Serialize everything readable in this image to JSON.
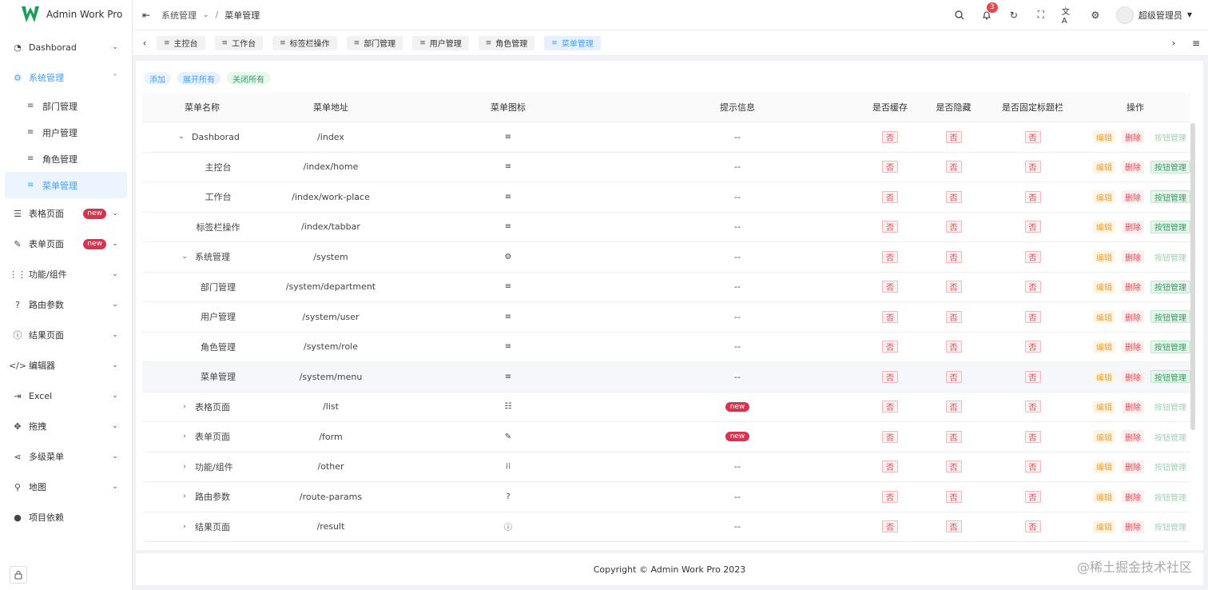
{
  "app": {
    "title": "Admin Work Pro"
  },
  "sidebar": {
    "items": [
      {
        "label": "Dashborad",
        "icon": "dashboard-icon",
        "glyph": "◔",
        "arrow": "⌄"
      },
      {
        "label": "系统管理",
        "icon": "gear-icon",
        "glyph": "⚙",
        "arrow": "⌃",
        "active": true
      },
      {
        "label": "表格页面",
        "icon": "list-icon",
        "glyph": "☰",
        "badge": "new",
        "arrow": "⌄"
      },
      {
        "label": "表单页面",
        "icon": "form-icon",
        "glyph": "✎",
        "badge": "new",
        "arrow": "⌄"
      },
      {
        "label": "功能/组件",
        "icon": "grid-icon",
        "glyph": "⋮⋮",
        "arrow": "⌄"
      },
      {
        "label": "路由参数",
        "icon": "question-icon",
        "glyph": "?",
        "arrow": "⌄"
      },
      {
        "label": "结果页面",
        "icon": "info-icon",
        "glyph": "ⓘ",
        "arrow": "⌄"
      },
      {
        "label": "编辑器",
        "icon": "code-icon",
        "glyph": "</>",
        "arrow": "⌄"
      },
      {
        "label": "Excel",
        "icon": "export-icon",
        "glyph": "⇥",
        "arrow": "⌄"
      },
      {
        "label": "拖拽",
        "icon": "move-icon",
        "glyph": "✥",
        "arrow": "⌄"
      },
      {
        "label": "多级菜单",
        "icon": "share-icon",
        "glyph": "⋖",
        "arrow": "⌄"
      },
      {
        "label": "地图",
        "icon": "location-icon",
        "glyph": "⚲",
        "arrow": "⌄"
      },
      {
        "label": "项目依赖",
        "icon": "github-icon",
        "glyph": "●"
      }
    ],
    "sub_items": [
      {
        "label": "部门管理"
      },
      {
        "label": "用户管理"
      },
      {
        "label": "角色管理"
      },
      {
        "label": "菜单管理",
        "active": true
      }
    ]
  },
  "header": {
    "breadcrumb": [
      "系统管理",
      "菜单管理"
    ],
    "notif_count": "3",
    "user_name": "超级管理员"
  },
  "tabs": [
    "主控台",
    "工作台",
    "标签栏操作",
    "部门管理",
    "用户管理",
    "角色管理",
    "菜单管理"
  ],
  "active_tab": 6,
  "actions": {
    "add": "添加",
    "expand": "展开所有",
    "collapse": "关闭所有"
  },
  "table": {
    "headers": [
      "菜单名称",
      "菜单地址",
      "菜单图标",
      "提示信息",
      "是否缓存",
      "是否隐藏",
      "是否固定标题栏",
      "操作"
    ],
    "no_label": "否",
    "edit_label": "编辑",
    "delete_label": "删除",
    "btn_mgr_label": "按钮管理",
    "rows": [
      {
        "name": "Dashborad",
        "path": "/index",
        "icon": "menu-icon",
        "glyph": "≡",
        "tip": "--",
        "level": 0,
        "caret": "⌄",
        "btn_enabled": false
      },
      {
        "name": "主控台",
        "path": "/index/home",
        "icon": "menu-icon",
        "glyph": "≡",
        "tip": "--",
        "level": 1,
        "btn_enabled": true
      },
      {
        "name": "工作台",
        "path": "/index/work-place",
        "icon": "menu-icon",
        "glyph": "≡",
        "tip": "--",
        "level": 1,
        "btn_enabled": true
      },
      {
        "name": "标签栏操作",
        "path": "/index/tabbar",
        "icon": "menu-icon",
        "glyph": "≡",
        "tip": "--",
        "level": 1,
        "btn_enabled": true
      },
      {
        "name": "系统管理",
        "path": "/system",
        "icon": "gear-icon",
        "glyph": "⚙",
        "tip": "--",
        "level": 0,
        "caret": "⌄",
        "btn_enabled": false
      },
      {
        "name": "部门管理",
        "path": "/system/department",
        "icon": "menu-icon",
        "glyph": "≡",
        "tip": "--",
        "level": 1,
        "btn_enabled": true
      },
      {
        "name": "用户管理",
        "path": "/system/user",
        "icon": "menu-icon",
        "glyph": "≡",
        "tip": "--",
        "level": 1,
        "btn_enabled": true
      },
      {
        "name": "角色管理",
        "path": "/system/role",
        "icon": "menu-icon",
        "glyph": "≡",
        "tip": "--",
        "level": 1,
        "btn_enabled": true
      },
      {
        "name": "菜单管理",
        "path": "/system/menu",
        "icon": "menu-icon",
        "glyph": "≡",
        "tip": "--",
        "level": 1,
        "btn_enabled": true,
        "highlight": true
      },
      {
        "name": "表格页面",
        "path": "/list",
        "icon": "list-icon",
        "glyph": "☷",
        "tip": "new",
        "tip_badge": true,
        "level": 0,
        "caret": "›",
        "btn_enabled": false
      },
      {
        "name": "表单页面",
        "path": "/form",
        "icon": "form-icon",
        "glyph": "✎",
        "tip": "new",
        "tip_badge": true,
        "level": 0,
        "caret": "›",
        "btn_enabled": false
      },
      {
        "name": "功能/组件",
        "path": "/other",
        "icon": "grid-icon",
        "glyph": "⁞⁞",
        "tip": "--",
        "level": 0,
        "caret": "›",
        "btn_enabled": false
      },
      {
        "name": "路由参数",
        "path": "/route-params",
        "icon": "question-icon",
        "glyph": "?",
        "tip": "--",
        "level": 0,
        "caret": "›",
        "btn_enabled": false
      },
      {
        "name": "结果页面",
        "path": "/result",
        "icon": "info-icon",
        "glyph": "ⓘ",
        "tip": "--",
        "level": 0,
        "caret": "›",
        "btn_enabled": false
      }
    ]
  },
  "footer": {
    "copyright": "Copyright © Admin Work Pro 2023"
  },
  "watermark": "@稀土掘金技术社区",
  "colors": {
    "primary": "#409eff",
    "danger": "#e5484d",
    "warning": "#e6a23c",
    "success": "#2ea05f",
    "badge": "#d9334f"
  }
}
